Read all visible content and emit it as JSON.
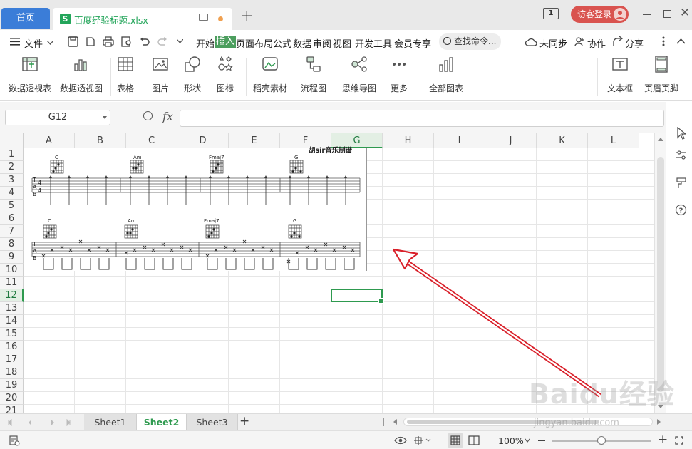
{
  "titlebar": {
    "home_tab": "首页",
    "file_tab": "百度经验标题.xlsx",
    "file_icon_letter": "S",
    "window_badge": "1",
    "login_label": "访客登录",
    "add_tab": "+"
  },
  "menu": {
    "file": "文件",
    "items": [
      "开始",
      "插入",
      "页面布局",
      "公式",
      "数据",
      "审阅",
      "视图",
      "开发工具",
      "会员专享"
    ],
    "active": "插入",
    "search": "查找命令...",
    "sync": "未同步",
    "collab": "协作",
    "share": "分享"
  },
  "ribbon": {
    "items": [
      "数据透视表",
      "数据透视图",
      "表格",
      "图片",
      "形状",
      "图标",
      "稻壳素材",
      "流程图",
      "思维导图",
      "更多",
      "全部图表",
      "文本框",
      "页眉页脚"
    ]
  },
  "formula": {
    "cell_ref": "G12",
    "fx": "fx",
    "content": ""
  },
  "grid": {
    "columns": [
      "A",
      "B",
      "C",
      "D",
      "E",
      "F",
      "G",
      "H",
      "I",
      "J",
      "K",
      "L"
    ],
    "rows": [
      "1",
      "2",
      "3",
      "4",
      "5",
      "6",
      "7",
      "8",
      "9",
      "10",
      "11",
      "12",
      "13",
      "14",
      "15",
      "16",
      "17",
      "18",
      "19",
      "20",
      "21"
    ],
    "selected_column": "G",
    "selected_row": "12"
  },
  "music_image": {
    "header": "胡sir音乐制谱",
    "chords_row1": [
      "C",
      "Am",
      "Fmaj7",
      "G"
    ],
    "chords_row2": [
      "C",
      "Am",
      "Fmaj7",
      "G"
    ],
    "tab_letters": [
      "T",
      "A",
      "B"
    ],
    "time_signature": [
      "4",
      "4"
    ]
  },
  "sheets": {
    "tabs": [
      "Sheet1",
      "Sheet2",
      "Sheet3"
    ],
    "active": "Sheet2",
    "add": "+"
  },
  "status": {
    "zoom": "100%",
    "zoom_level": 1.0
  },
  "watermark": {
    "text": "Baidu经验",
    "url": "jingyan.baidu.com"
  },
  "colors": {
    "accent_green": "#2e9a4f",
    "home_tab_blue": "#3b7dd8",
    "login_red": "#d9534f",
    "arrow_red": "#d9202a"
  }
}
